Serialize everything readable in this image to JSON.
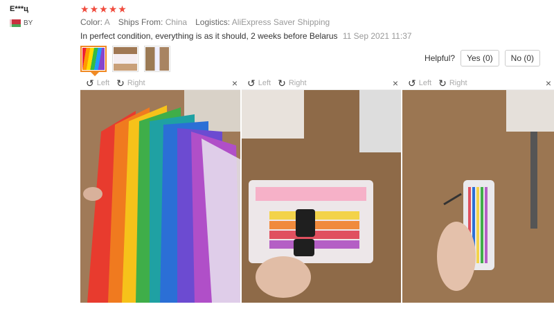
{
  "reviewer": {
    "name": "E***ц",
    "country": "BY"
  },
  "rating": {
    "stars": 5,
    "star_glyph": "★"
  },
  "attributes": {
    "color_label": "Color:",
    "color_value": "A",
    "ships_label": "Ships From:",
    "ships_value": "China",
    "logistics_label": "Logistics:",
    "logistics_value": "AliExpress Saver Shipping"
  },
  "review": {
    "text": "In perfect condition, everything is as it should, 2 weeks before Belarus",
    "date": "11 Sep 2021 11:37"
  },
  "helpful": {
    "label": "Helpful?",
    "yes": "Yes (0)",
    "no": "No (0)"
  },
  "viewer": {
    "rotate_left": "Left",
    "rotate_right": "Right",
    "close": "×"
  },
  "colors": {
    "star": "#f04b3d",
    "active_thumb": "#f08a24"
  }
}
